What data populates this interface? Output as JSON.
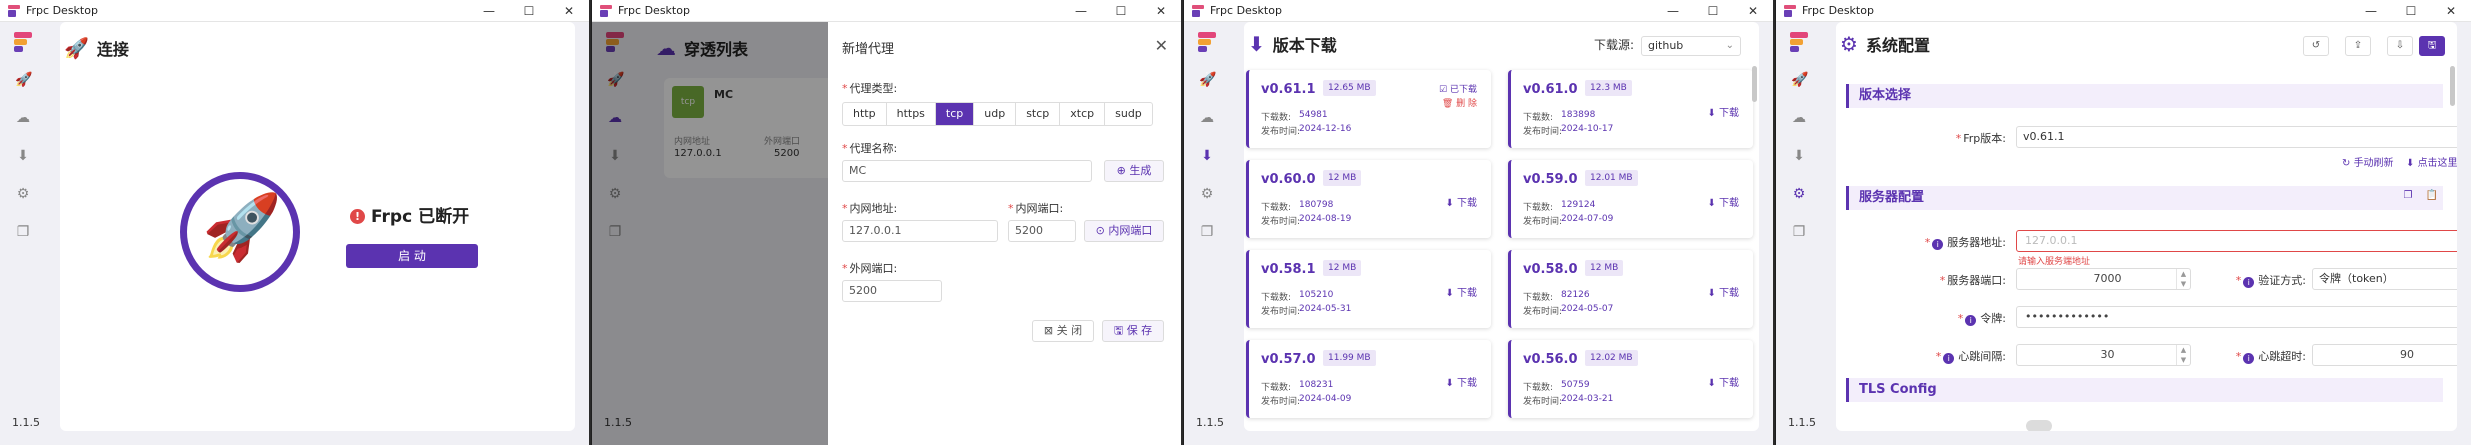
{
  "app": {
    "title": "Frpc Desktop",
    "version": "1.1.5"
  },
  "window_controls": {
    "minimize": "—",
    "maximize": "☐",
    "close": "✕"
  },
  "nav_icons": [
    "rocket-icon",
    "cloud-icon",
    "download-icon",
    "gear-icon",
    "copy-icon"
  ],
  "connect": {
    "title": "连接",
    "status_text": "Frpc 已断开",
    "status_mark": "!",
    "start_label": "启 动"
  },
  "proxies": {
    "title": "穿透列表",
    "card": {
      "type": "tcp",
      "name": "MC",
      "local_addr_label": "内网地址",
      "remote_port_label": "外网端口",
      "local_addr": "127.0.0.1",
      "remote_port": "5200"
    }
  },
  "dialog": {
    "title": "新增代理",
    "type_label": "代理类型:",
    "types": [
      "http",
      "https",
      "tcp",
      "udp",
      "stcp",
      "xtcp",
      "sudp"
    ],
    "selected_type": "tcp",
    "name_label": "代理名称:",
    "name_value": "MC",
    "generate_label": "生成",
    "local_addr_label": "内网地址:",
    "local_addr_value": "127.0.0.1",
    "local_port_label": "内网端口:",
    "local_port_value": "5200",
    "local_port_btn": "内网端口",
    "remote_port_label": "外网端口:",
    "remote_port_value": "5200",
    "close_label": "关 闭",
    "save_label": "保 存"
  },
  "download": {
    "title": "版本下载",
    "source_label": "下载源:",
    "source_value": "github",
    "labels": {
      "downloads": "下载数:",
      "published": "发布时间:",
      "download": "下载",
      "downloaded": "已下载",
      "delete": "删 除"
    },
    "versions": [
      {
        "name": "v0.61.1",
        "size": "12.65 MB",
        "downloads": "54981",
        "date": "2024-12-16",
        "installed": true
      },
      {
        "name": "v0.61.0",
        "size": "12.3 MB",
        "downloads": "183898",
        "date": "2024-10-17"
      },
      {
        "name": "v0.60.0",
        "size": "12 MB",
        "downloads": "180798",
        "date": "2024-08-19"
      },
      {
        "name": "v0.59.0",
        "size": "12.01 MB",
        "downloads": "129124",
        "date": "2024-07-09"
      },
      {
        "name": "v0.58.1",
        "size": "12 MB",
        "downloads": "105210",
        "date": "2024-05-31"
      },
      {
        "name": "v0.58.0",
        "size": "12 MB",
        "downloads": "82126",
        "date": "2024-05-07"
      },
      {
        "name": "v0.57.0",
        "size": "11.99 MB",
        "downloads": "108231",
        "date": "2024-04-09"
      },
      {
        "name": "v0.56.0",
        "size": "12.02 MB",
        "downloads": "50759",
        "date": "2024-03-21"
      }
    ]
  },
  "config": {
    "title": "系统配置",
    "toolbar_icons": [
      "history-icon",
      "export-icon",
      "import-icon",
      "save-icon"
    ],
    "version_section": "版本选择",
    "frp_version_label": "Frp版本:",
    "frp_version_value": "v0.61.1",
    "refresh_label": "手动刷新",
    "download_here_label": "点击这里去下载",
    "server_section": "服务器配置",
    "server_addr_label": "服务器地址:",
    "server_addr_placeholder": "127.0.0.1",
    "server_addr_error": "请输入服务端地址",
    "server_port_label": "服务器端口:",
    "server_port_value": "7000",
    "auth_label": "验证方式:",
    "auth_value": "令牌（token）",
    "token_label": "令牌:",
    "token_value": "•••••••••••••",
    "heartbeat_interval_label": "心跳间隔:",
    "heartbeat_interval_value": "30",
    "heartbeat_timeout_label": "心跳超时:",
    "heartbeat_timeout_value": "90",
    "tls_section": "TLS Config"
  },
  "colors": {
    "accent": "#5b33b0",
    "error": "#e04848",
    "tcp_badge": "#7cb342"
  }
}
